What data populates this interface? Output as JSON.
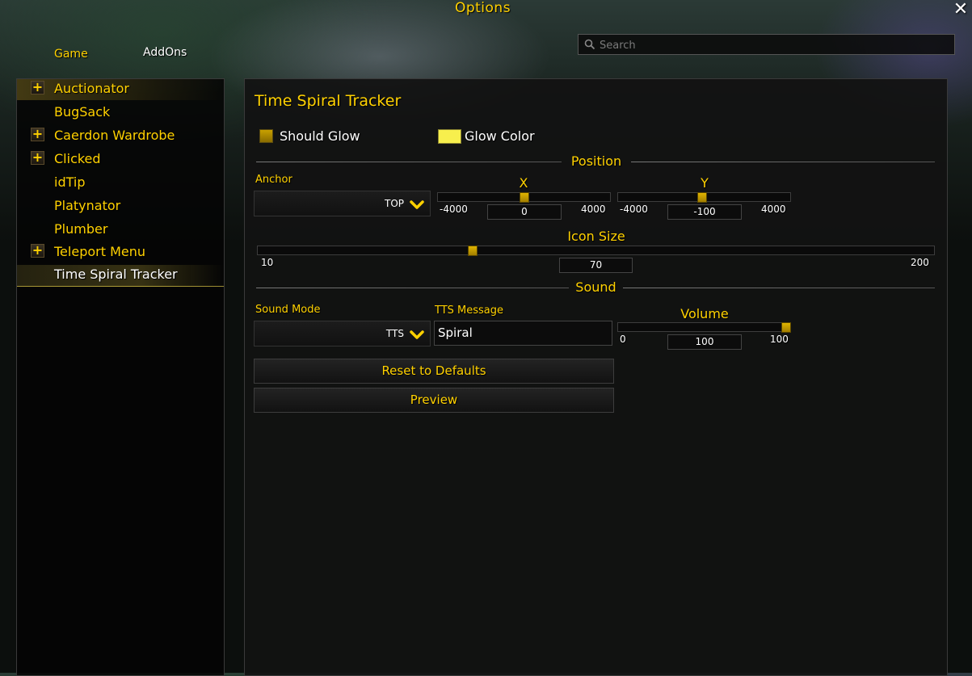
{
  "window": {
    "title": "Options",
    "close_icon": "close-icon"
  },
  "tabs": [
    {
      "label": "Game"
    },
    {
      "label": "AddOns"
    }
  ],
  "search": {
    "placeholder": "Search",
    "value": ""
  },
  "sidebar": {
    "items": [
      {
        "label": "Auctionator",
        "expandable": true,
        "state": "highlighted"
      },
      {
        "label": "BugSack",
        "expandable": false
      },
      {
        "label": "Caerdon Wardrobe",
        "expandable": true
      },
      {
        "label": "Clicked",
        "expandable": true
      },
      {
        "label": "idTip",
        "expandable": false
      },
      {
        "label": "Platynator",
        "expandable": false
      },
      {
        "label": "Plumber",
        "expandable": false
      },
      {
        "label": "Teleport Menu",
        "expandable": true
      },
      {
        "label": "Time Spiral Tracker",
        "expandable": false,
        "state": "selected"
      }
    ],
    "expand_glyph": "+"
  },
  "panel": {
    "title": "Time Spiral Tracker",
    "should_glow": {
      "label": "Should Glow",
      "checked": true
    },
    "glow_color": {
      "label": "Glow Color",
      "color": "#f7ef4d"
    },
    "position": {
      "section_title": "Position",
      "anchor": {
        "label": "Anchor",
        "value": "TOP"
      },
      "x": {
        "label": "X",
        "min": "-4000",
        "max": "4000",
        "value": "0",
        "fraction": 0.5
      },
      "y": {
        "label": "Y",
        "min": "-4000",
        "max": "4000",
        "value": "-100",
        "fraction": 0.4875
      }
    },
    "icon_size": {
      "label": "Icon Size",
      "min": "10",
      "max": "200",
      "value": "70",
      "fraction": 0.316
    },
    "sound": {
      "section_title": "Sound",
      "mode": {
        "label": "Sound Mode",
        "value": "TTS"
      },
      "tts_message": {
        "label": "TTS Message",
        "value": "Spiral"
      },
      "volume": {
        "label": "Volume",
        "min": "0",
        "max": "100",
        "value": "100",
        "fraction": 1.0
      }
    },
    "buttons": {
      "reset": "Reset to Defaults",
      "preview": "Preview"
    }
  },
  "colors": {
    "gold": "#ffd100",
    "slider_thumb": "#c89e00",
    "glow_swatch": "#f7ef4d"
  }
}
